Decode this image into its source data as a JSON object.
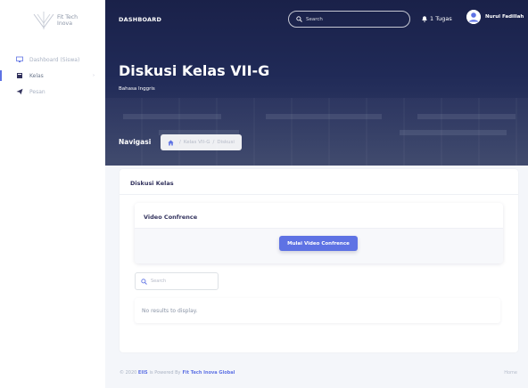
{
  "sidebar": {
    "brand": {
      "line1": "Fit Tech",
      "line2": "Inova"
    },
    "items": [
      {
        "label": "Dashboard (Siswa)",
        "icon": "monitor-icon"
      },
      {
        "label": "Kelas",
        "icon": "book-icon",
        "chevron": "›"
      },
      {
        "label": "Pesan",
        "icon": "send-icon"
      }
    ]
  },
  "header": {
    "title": "DASHBOARD",
    "search_placeholder": "Search",
    "tasks": "1 Tugas",
    "user_name": "Nurul Fadillah",
    "page_title": "Diskusi Kelas VII-G",
    "page_subtitle": "Bahasa Inggris",
    "nav_label": "Navigasi",
    "breadcrumb": [
      "Kelas VII-G",
      "Diskusi"
    ],
    "breadcrumb_sep": "/"
  },
  "main": {
    "card_title": "Diskusi Kelas",
    "video": {
      "title": "Video Confrence",
      "button": "Mulai Video Confrence"
    },
    "search_placeholder": "Search",
    "empty_text": "No results to display."
  },
  "footer": {
    "prefix": "© 2020",
    "brand": "EIIS",
    "powered": "is Powered By",
    "company": "Fit Tech Inova Global",
    "right_link": "Home"
  },
  "colors": {
    "accent": "#5e72e4",
    "header_bg": "#1a2149",
    "page_bg": "#f4f6fa"
  }
}
